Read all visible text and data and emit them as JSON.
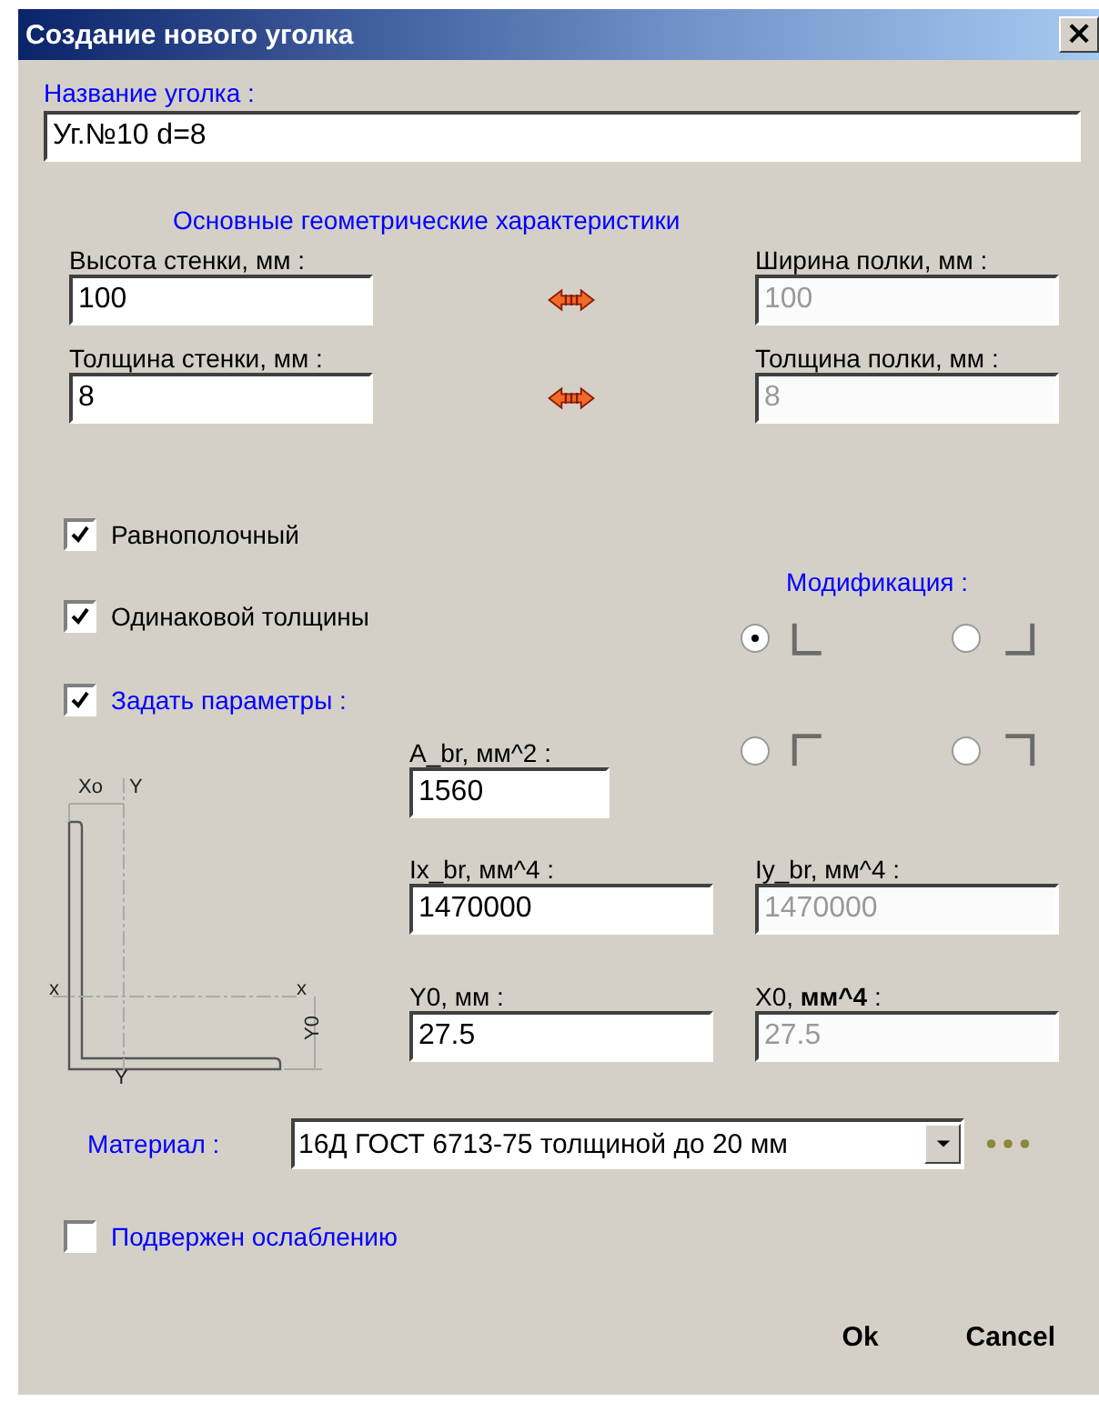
{
  "window": {
    "title": "Создание нового уголка",
    "close": "×"
  },
  "name_field": {
    "label": "Название уголка :",
    "value": "Уг.№10 d=8"
  },
  "section_heading": "Основные геометрические характеристики",
  "dimension_rows": [
    {
      "left": {
        "label": "Высота стенки, мм :",
        "value": "100",
        "disabled": false
      },
      "right": {
        "label": "Ширина  полки, мм :",
        "value": "100",
        "disabled": true
      }
    },
    {
      "left": {
        "label": "Толщина стенки, мм :",
        "value": "8",
        "disabled": false
      },
      "right": {
        "label": "Толщина  полки, мм :",
        "value": "8",
        "disabled": true
      }
    }
  ],
  "checkboxes": [
    {
      "label": "Равнополочный",
      "checked": true,
      "accent": false
    },
    {
      "label": "Одинаковой толщины",
      "checked": true,
      "accent": false
    },
    {
      "label": "Задать параметры :",
      "checked": true,
      "accent": true
    }
  ],
  "modification": {
    "label": "Модификация :",
    "options": [
      {
        "kind": "lowerleft",
        "selected": true
      },
      {
        "kind": "lowerright",
        "selected": false
      },
      {
        "kind": "upperleft",
        "selected": false
      },
      {
        "kind": "upperright",
        "selected": false
      }
    ]
  },
  "diagram": {
    "labels": [
      "Xo",
      "Y",
      "x",
      "x",
      "Y0",
      "Y"
    ]
  },
  "params": [
    {
      "label": "A_br, мм^2 :",
      "value": "1560",
      "disabled": false
    },
    {
      "label": "Ix_br, мм^4 :",
      "value": "1470000",
      "disabled": false
    },
    {
      "label": "Iy_br, мм^4 :",
      "value": "1470000",
      "disabled": true
    },
    {
      "label": "Y0, мм :",
      "value": "27.5",
      "disabled": false
    },
    {
      "label": "X0, **мм^4** :",
      "value": "27.5",
      "disabled": true
    }
  ],
  "material": {
    "label": "Материал :",
    "value": "16Д ГОСТ 6713-75 толщиной до 20 мм"
  },
  "weakened": {
    "label": "Подвержен ослаблению",
    "checked": false
  },
  "buttons": [
    "Ok",
    "Cancel"
  ]
}
